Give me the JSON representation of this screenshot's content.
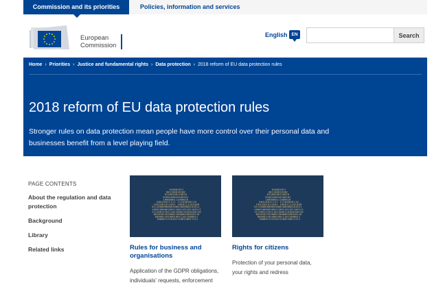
{
  "top_nav": {
    "active_tab": "Commission and its priorities",
    "tab2": "Policies, information and services"
  },
  "logo": {
    "line1": "European",
    "line2": "Commission"
  },
  "language": {
    "label": "English",
    "badge": "EN"
  },
  "search": {
    "placeholder": "",
    "button_label": "Search"
  },
  "breadcrumb": {
    "items": [
      "Home",
      "Priorities",
      "Justice and fundamental rights",
      "Data protection"
    ],
    "separator": "›",
    "current": "2018 reform of EU data protection rules"
  },
  "hero": {
    "title": "2018 reform of EU data protection rules",
    "description": "Stronger rules on data protection mean people have more control over their personal data and businesses benefit from a level playing field."
  },
  "page_contents": {
    "heading": "PAGE CONTENTS",
    "links": [
      "About the regulation and data protection",
      "Background",
      "Library",
      "Related links"
    ]
  },
  "cards": [
    {
      "title": "Rules for business and organisations",
      "description": "Application of the GDPR obligations, individuals' requests, enforcement",
      "icon": "cloud-binary-icon"
    },
    {
      "title": "Rights for citizens",
      "description": "Protection of your personal data, your rights and redress",
      "icon": "cloud-binary-icon"
    }
  ],
  "colors": {
    "brand_blue": "#004494",
    "card_image_bg": "#1e3a5a",
    "binary_digits": "#e6c27a"
  }
}
